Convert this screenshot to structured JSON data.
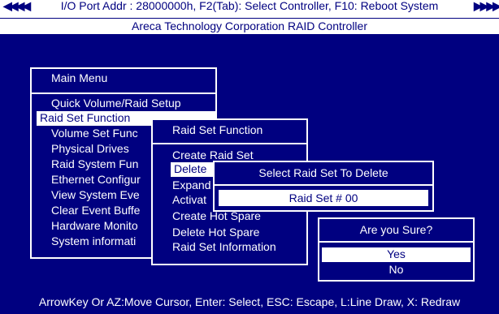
{
  "header": {
    "port_line": "I/O Port Addr : 28000000h, F2(Tab): Select Controller, F10: Reboot System",
    "left_arrows": "◀◀◀◀",
    "right_arrows": "▶▶▶▶",
    "controller_title": "Areca Technology Corporation RAID Controller"
  },
  "main_menu": {
    "title": "Main Menu",
    "items": [
      "Quick Volume/Raid Setup",
      "Raid Set Function",
      "Volume Set Func",
      "Physical Drives",
      "Raid System Fun",
      "Ethernet Configur",
      "View System Eve",
      "Clear Event Buffe",
      "Hardware Monito",
      "System informati"
    ]
  },
  "raid_set_menu": {
    "title": "Raid Set Function",
    "items": [
      "Create Raid Set",
      "Delete",
      "Expand",
      "Activat",
      "Create Hot Spare",
      "Delete Hot Spare",
      "Raid Set Information"
    ]
  },
  "select_delete": {
    "title": "Select Raid Set To Delete",
    "entry": "Raid Set   #   00"
  },
  "confirm": {
    "title": "Are you Sure?",
    "yes": "Yes",
    "no": "No"
  },
  "footer": {
    "hint": "ArrowKey Or AZ:Move Cursor, Enter: Select, ESC: Escape, L:Line Draw, X: Redraw"
  },
  "colors": {
    "background": "#000080",
    "foreground": "#ffffff"
  }
}
